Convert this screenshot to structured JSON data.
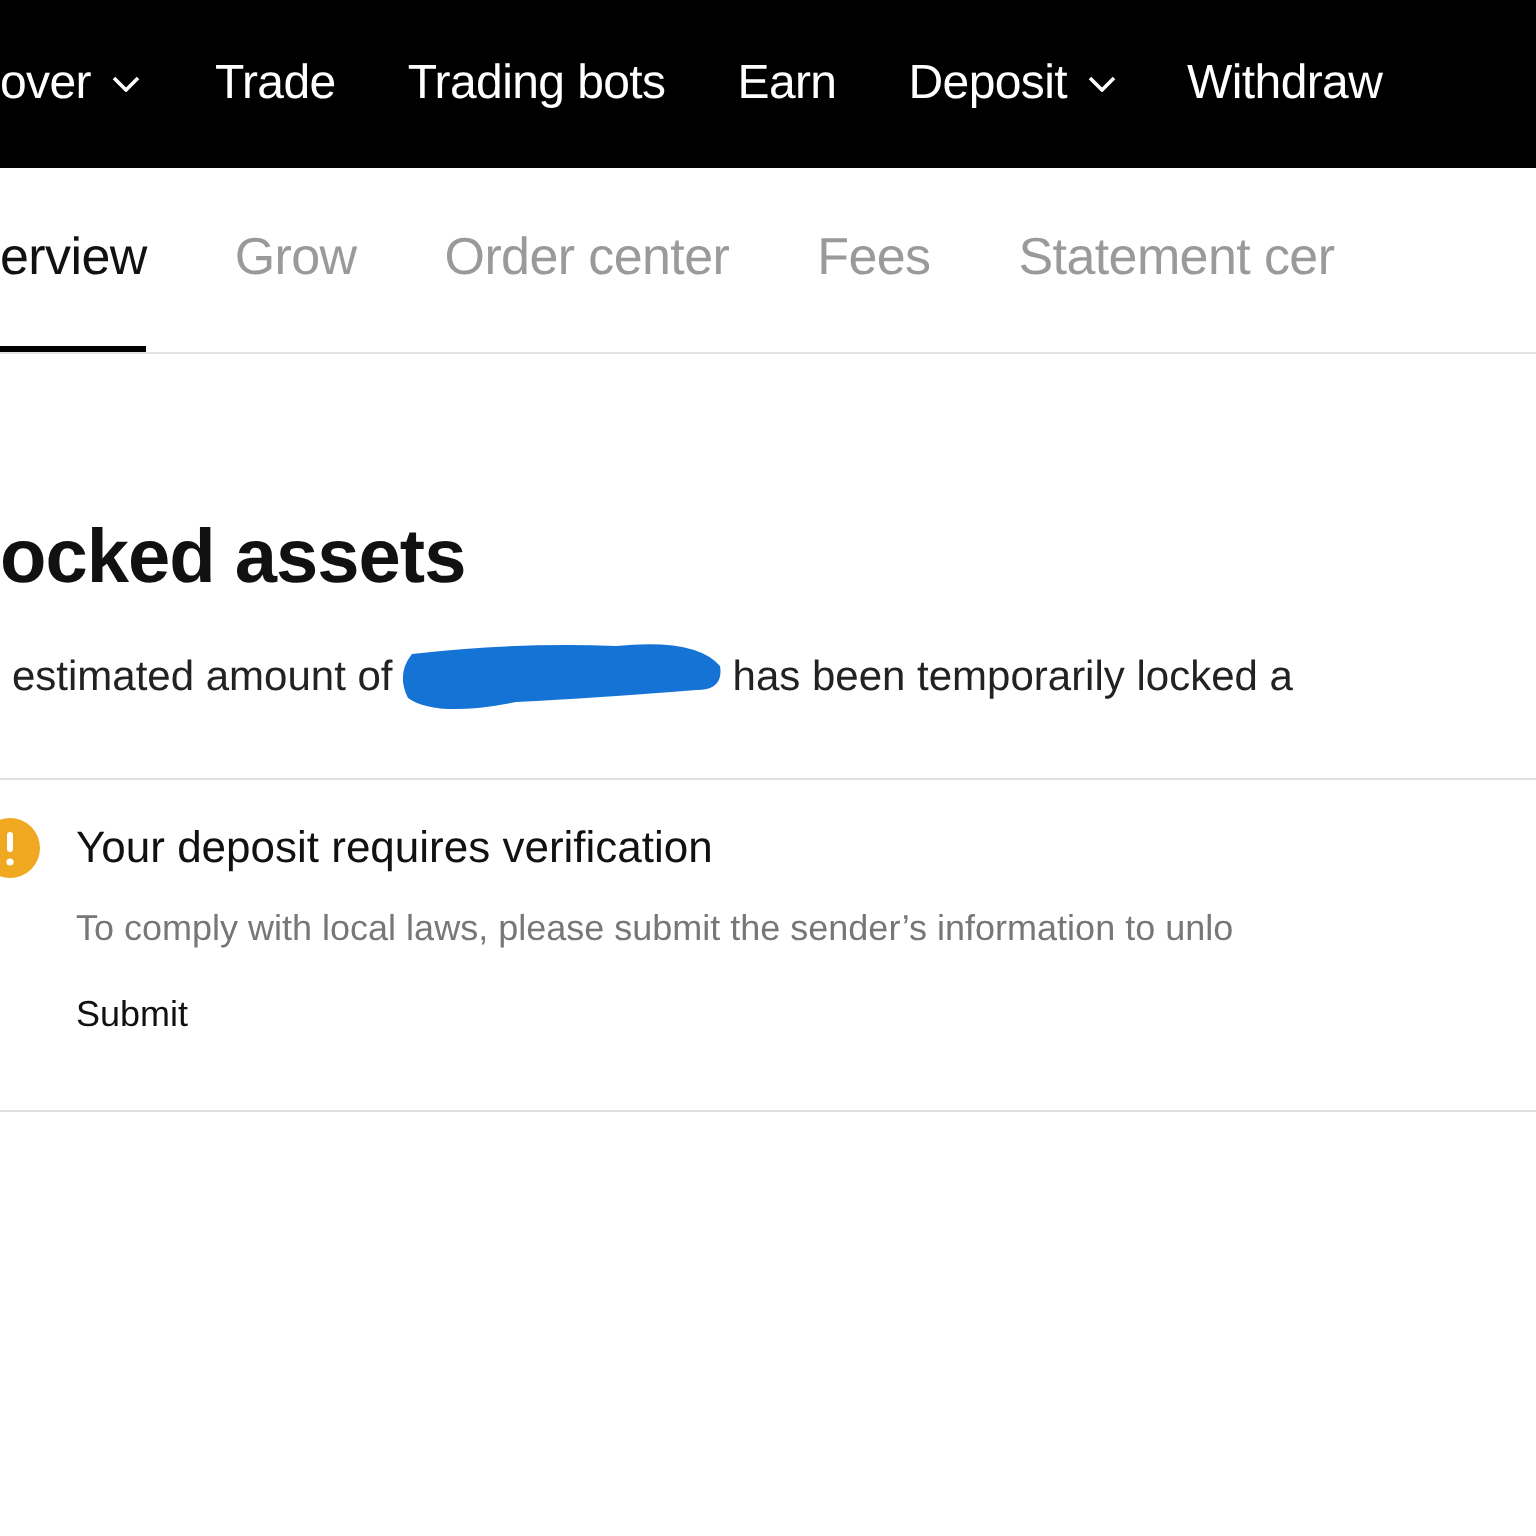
{
  "nav": [
    {
      "label": "over",
      "dropdown": true
    },
    {
      "label": "Trade",
      "dropdown": false
    },
    {
      "label": "Trading bots",
      "dropdown": false
    },
    {
      "label": "Earn",
      "dropdown": false
    },
    {
      "label": "Deposit",
      "dropdown": true
    },
    {
      "label": "Withdraw",
      "dropdown": false
    }
  ],
  "tabs": [
    {
      "label": "erview",
      "selected": true
    },
    {
      "label": "Grow",
      "selected": false
    },
    {
      "label": "Order center",
      "selected": false
    },
    {
      "label": "Fees",
      "selected": false
    },
    {
      "label": "Statement cer",
      "selected": false
    }
  ],
  "heading": "ocked assets",
  "notice": {
    "before": "estimated amount of",
    "after": "has been temporarily locked a"
  },
  "alert": {
    "kind": "warning",
    "title": "Your deposit requires verification",
    "message": "To comply with local laws, please submit the sender’s information to unlo",
    "button": "Submit"
  }
}
